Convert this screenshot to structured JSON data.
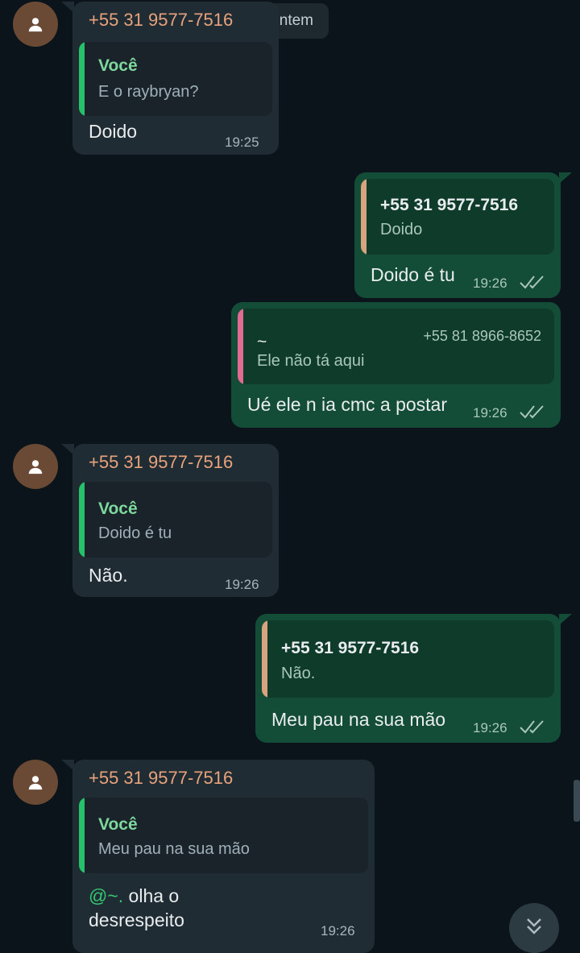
{
  "date_chip": "Ontem",
  "colors": {
    "incoming_bubble": "#202c33",
    "outgoing_bubble": "#144d37",
    "background": "#0b141a",
    "sender_name": "#e8a27c",
    "you_quote_bar": "#25c26a",
    "orange_quote_bar": "#d8a47f",
    "pink_quote_bar": "#e26b93",
    "you_name": "#7ed89e",
    "mention": "#34c771"
  },
  "messages": [
    {
      "direction": "in",
      "sender": "+55 31 9577-7516",
      "quote": {
        "title": "Você",
        "text": "E o raybryan?"
      },
      "text": "Doido",
      "time": "19:25"
    },
    {
      "direction": "out",
      "quote": {
        "title": "+55 31 9577-7516",
        "text": "Doido"
      },
      "text": "Doido é tu",
      "time": "19:26",
      "status_icon": "double-check-icon"
    },
    {
      "direction": "out",
      "quote": {
        "title": "~",
        "phone": "+55 81 8966-8652",
        "text": "Ele não tá aqui"
      },
      "text": "Ué ele n ia cmc a postar",
      "time": "19:26",
      "status_icon": "double-check-icon"
    },
    {
      "direction": "in",
      "sender": "+55 31 9577-7516",
      "quote": {
        "title": "Você",
        "text": "Doido é tu"
      },
      "text": "Não.",
      "time": "19:26"
    },
    {
      "direction": "out",
      "quote": {
        "title": "+55 31 9577-7516",
        "text": "Não."
      },
      "text": "Meu pau na sua mão",
      "time": "19:26",
      "status_icon": "double-check-icon"
    },
    {
      "direction": "in",
      "sender": "+55 31 9577-7516",
      "quote": {
        "title": "Você",
        "text": "Meu pau na sua mão"
      },
      "mention": "@~.",
      "text_line1": " olha o",
      "text_line2": "desrespeito",
      "time": "19:26"
    }
  ],
  "scroll_button_icon": "double-chevron-down-icon",
  "avatar_icon": "person-icon"
}
